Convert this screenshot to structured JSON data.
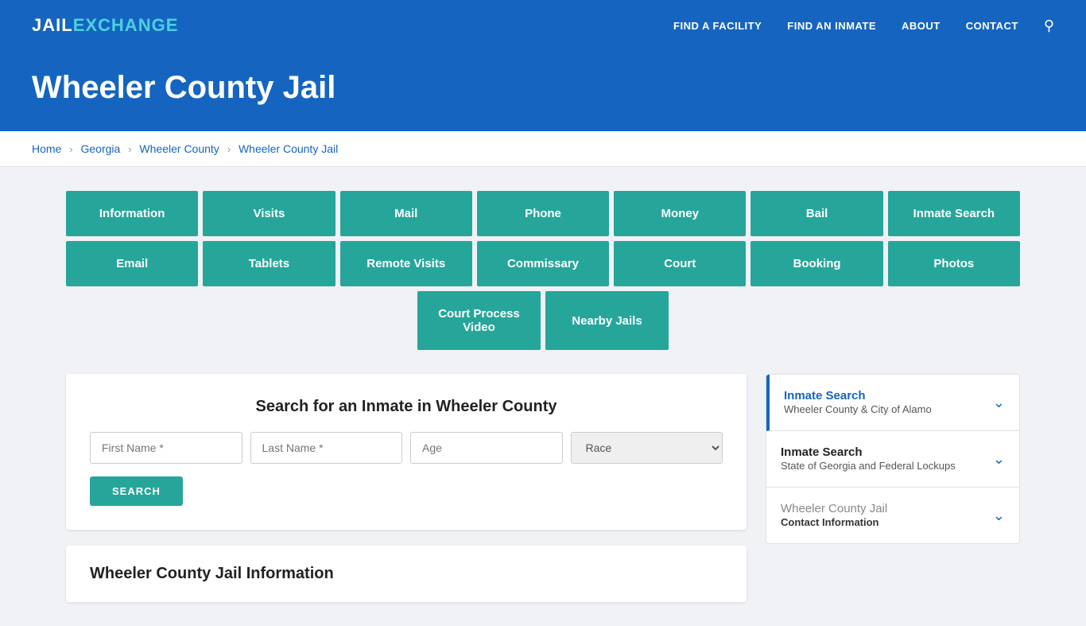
{
  "header": {
    "logo_jail": "JAIL",
    "logo_exchange": "EXCHANGE",
    "nav": [
      {
        "label": "FIND A FACILITY",
        "id": "find-facility"
      },
      {
        "label": "FIND AN INMATE",
        "id": "find-inmate"
      },
      {
        "label": "ABOUT",
        "id": "about"
      },
      {
        "label": "CONTACT",
        "id": "contact"
      }
    ]
  },
  "title_banner": {
    "title": "Wheeler County Jail"
  },
  "breadcrumb": {
    "items": [
      {
        "label": "Home",
        "id": "home"
      },
      {
        "label": "Georgia",
        "id": "georgia"
      },
      {
        "label": "Wheeler County",
        "id": "wheeler-county"
      },
      {
        "label": "Wheeler County Jail",
        "id": "wheeler-county-jail"
      }
    ]
  },
  "button_grid": {
    "row1": [
      {
        "label": "Information",
        "id": "information"
      },
      {
        "label": "Visits",
        "id": "visits"
      },
      {
        "label": "Mail",
        "id": "mail"
      },
      {
        "label": "Phone",
        "id": "phone"
      },
      {
        "label": "Money",
        "id": "money"
      },
      {
        "label": "Bail",
        "id": "bail"
      },
      {
        "label": "Inmate Search",
        "id": "inmate-search"
      }
    ],
    "row2": [
      {
        "label": "Email",
        "id": "email"
      },
      {
        "label": "Tablets",
        "id": "tablets"
      },
      {
        "label": "Remote Visits",
        "id": "remote-visits"
      },
      {
        "label": "Commissary",
        "id": "commissary"
      },
      {
        "label": "Court",
        "id": "court"
      },
      {
        "label": "Booking",
        "id": "booking"
      },
      {
        "label": "Photos",
        "id": "photos"
      }
    ],
    "row3": [
      {
        "label": "Court Process Video",
        "id": "court-process-video"
      },
      {
        "label": "Nearby Jails",
        "id": "nearby-jails"
      }
    ]
  },
  "search_panel": {
    "title": "Search for an Inmate in Wheeler County",
    "fields": {
      "first_name": {
        "placeholder": "First Name *",
        "id": "first-name"
      },
      "last_name": {
        "placeholder": "Last Name *",
        "id": "last-name"
      },
      "age": {
        "placeholder": "Age",
        "id": "age"
      },
      "race": {
        "placeholder": "Race",
        "id": "race"
      }
    },
    "search_button": "SEARCH"
  },
  "info_section": {
    "title": "Wheeler County Jail Information"
  },
  "sidebar": {
    "items": [
      {
        "id": "inmate-search-wheeler",
        "label": "Inmate Search",
        "sublabel": "Wheeler County & City of Alamo",
        "active": true
      },
      {
        "id": "inmate-search-georgia",
        "label": "Inmate Search",
        "sublabel": "State of Georgia and Federal Lockups",
        "active": false
      },
      {
        "id": "contact-info",
        "label": "Wheeler County Jail",
        "sublabel": "Contact Information",
        "active": false,
        "muted": true
      }
    ]
  }
}
